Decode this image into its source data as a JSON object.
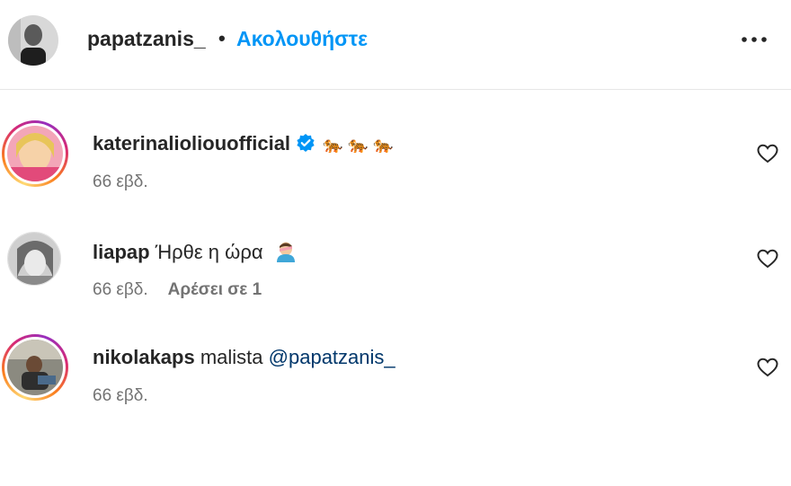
{
  "header": {
    "username": "papatzanis_",
    "separator": "•",
    "follow_label": "Ακολουθήστε",
    "more_icon": "more-horizontal-icon"
  },
  "comments": [
    {
      "username": "katerinalioliouofficial",
      "verified": true,
      "text": "🐅 🐅 🐅",
      "time": "66 εβδ.",
      "likes": "",
      "story_ring": true
    },
    {
      "username": "liapap",
      "verified": false,
      "text": "Ήρθε η ώρα 🤦‍♂️",
      "text_main": "Ήρθε η ώρα",
      "time": "66 εβδ.",
      "likes": "Αρέσει σε 1",
      "story_ring": false
    },
    {
      "username": "nikolakaps",
      "verified": false,
      "text_main": "malista",
      "mention": "@papatzanis_",
      "time": "66 εβδ.",
      "likes": "",
      "story_ring": true
    }
  ],
  "colors": {
    "accent": "#0095f6",
    "mention": "#00376b",
    "secondary_text": "#737373",
    "verified_badge": "#0095f6"
  }
}
